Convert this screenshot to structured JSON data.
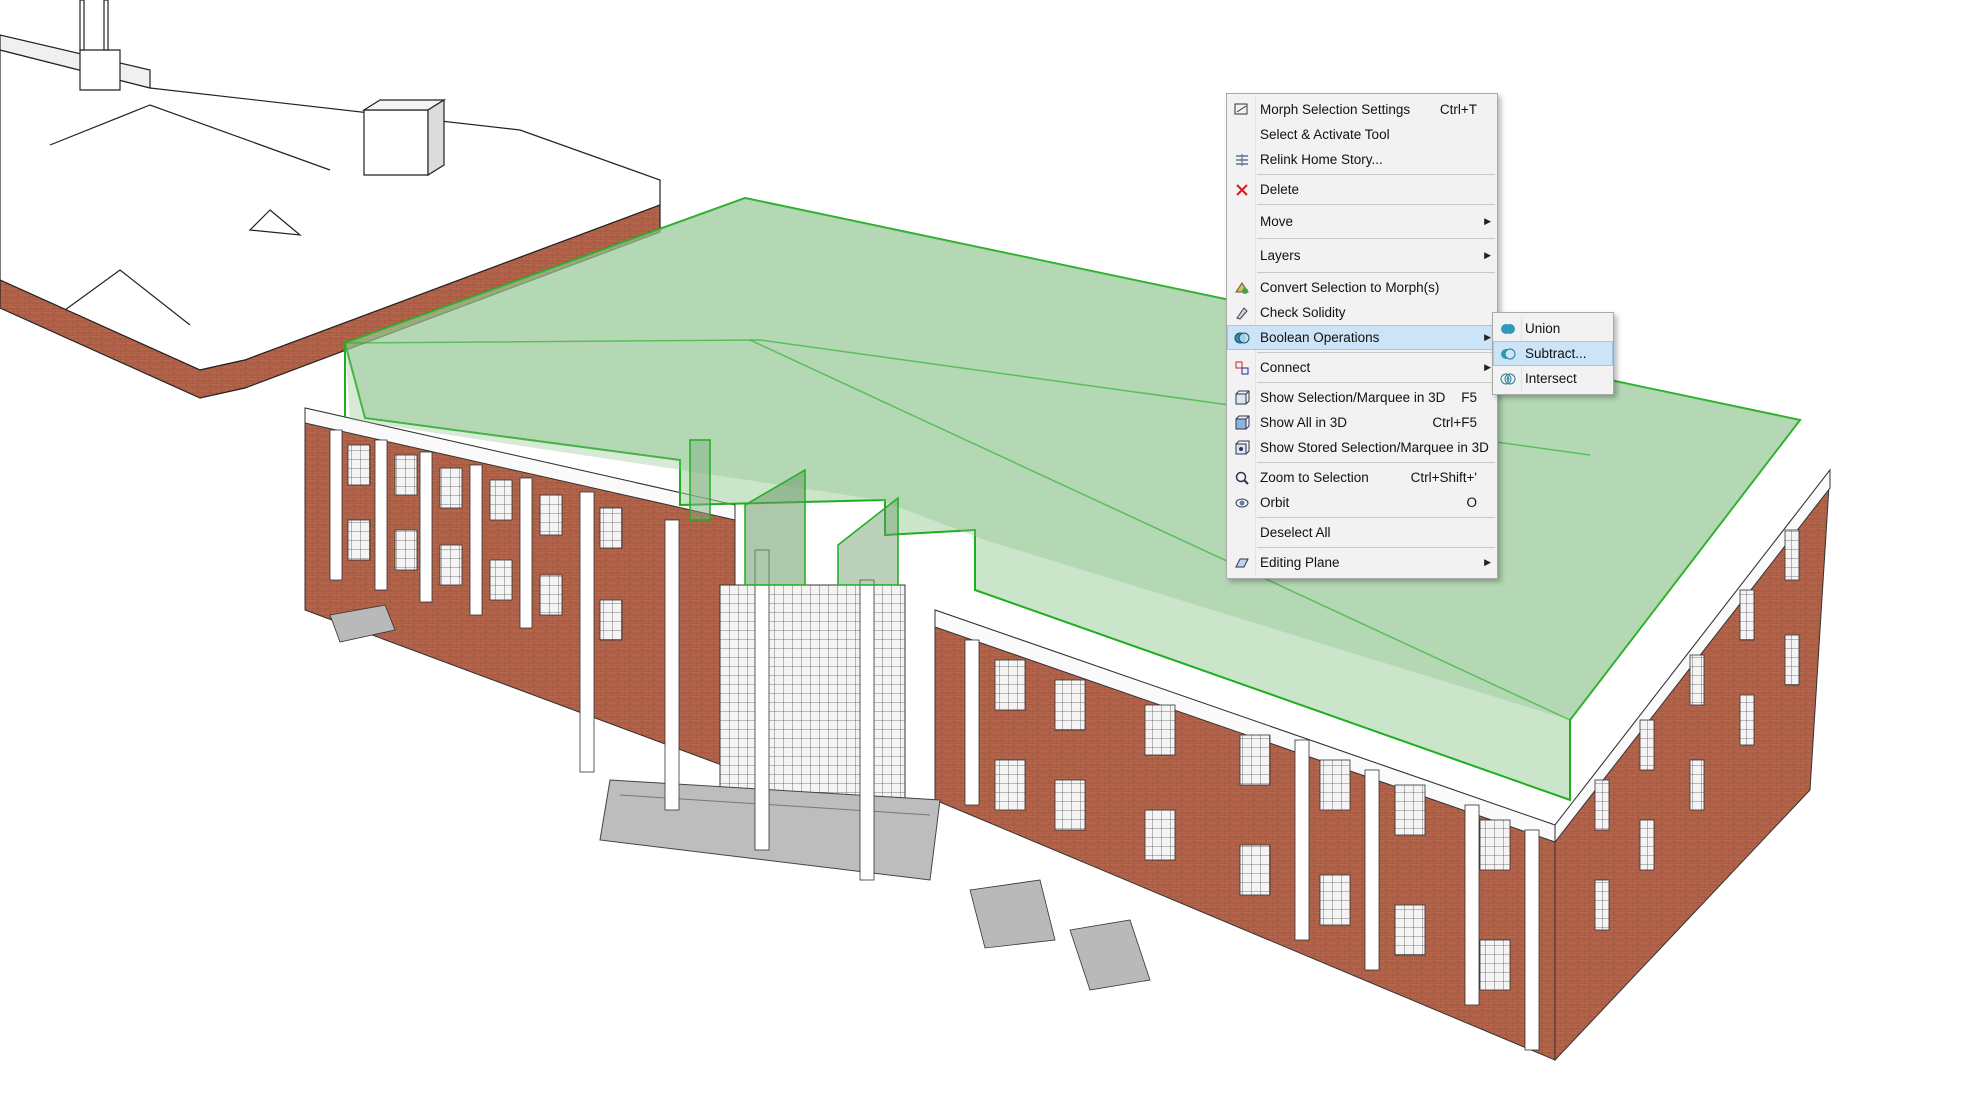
{
  "context_menu": {
    "items": [
      {
        "label": "Morph Selection Settings",
        "shortcut": "Ctrl+T",
        "icon": "morph-settings-icon"
      },
      {
        "label": "Select & Activate Tool",
        "shortcut": "",
        "icon": ""
      },
      {
        "label": "Relink Home Story...",
        "shortcut": "",
        "icon": "relink-story-icon"
      },
      {
        "label": "Delete",
        "shortcut": "",
        "icon": "delete-x-icon"
      },
      {
        "label": "Move",
        "shortcut": "",
        "icon": "",
        "submenu": true
      },
      {
        "label": "Layers",
        "shortcut": "",
        "icon": "",
        "submenu": true
      },
      {
        "label": "Convert Selection to Morph(s)",
        "shortcut": "",
        "icon": "convert-morph-icon"
      },
      {
        "label": "Check Solidity",
        "shortcut": "",
        "icon": "check-solidity-icon"
      },
      {
        "label": "Boolean Operations",
        "shortcut": "",
        "icon": "boolean-icon",
        "submenu": true
      },
      {
        "label": "Connect",
        "shortcut": "",
        "icon": "connect-icon",
        "submenu": true
      },
      {
        "label": "Show Selection/Marquee in 3D",
        "shortcut": "F5",
        "icon": "show-3d-icon"
      },
      {
        "label": "Show All in 3D",
        "shortcut": "Ctrl+F5",
        "icon": "show-all-3d-icon"
      },
      {
        "label": "Show Stored Selection/Marquee in 3D",
        "shortcut": "",
        "icon": "stored-3d-icon"
      },
      {
        "label": "Zoom to Selection",
        "shortcut": "Ctrl+Shift+'",
        "icon": "zoom-icon"
      },
      {
        "label": "Orbit",
        "shortcut": "O",
        "icon": "orbit-icon"
      },
      {
        "label": "Deselect All",
        "shortcut": "",
        "icon": ""
      },
      {
        "label": "Editing Plane",
        "shortcut": "",
        "icon": "editing-plane-icon",
        "submenu": true
      }
    ]
  },
  "boolean_submenu": {
    "items": [
      {
        "label": "Union",
        "icon": "union-icon"
      },
      {
        "label": "Subtract...",
        "icon": "subtract-icon"
      },
      {
        "label": "Intersect",
        "icon": "intersect-icon"
      }
    ]
  },
  "colors": {
    "morph_fill": "#9fcf9f",
    "morph_edge": "#1fae1f",
    "brick": "#b5654b",
    "menu_bg": "#f2f2f2",
    "menu_active": "#cce4f7"
  }
}
